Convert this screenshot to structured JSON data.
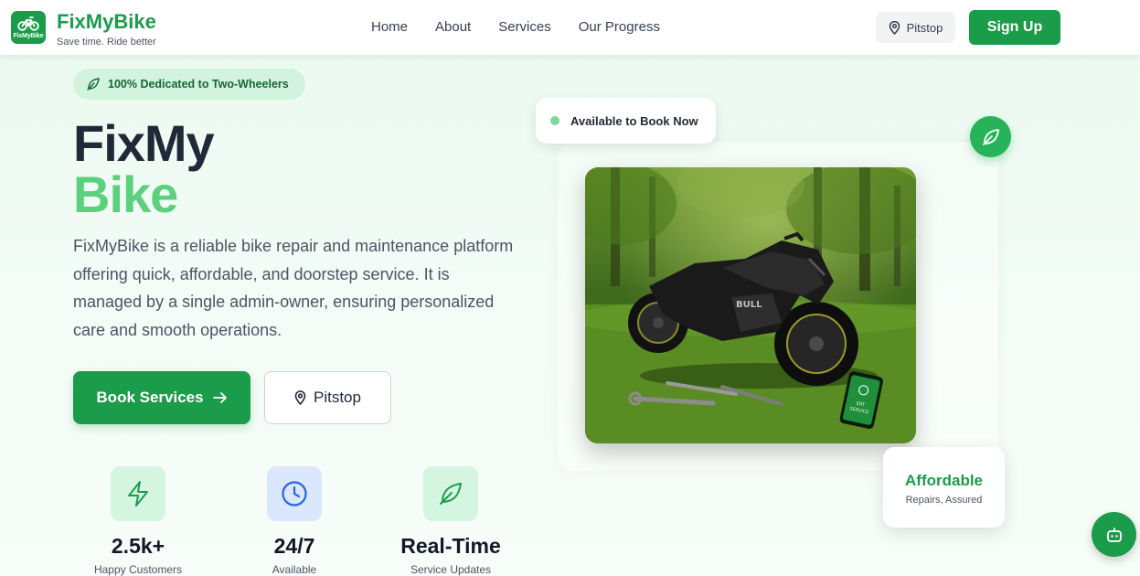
{
  "navbar": {
    "logo_mini_text": "FixMyBike",
    "brand_name": "FixMyBike",
    "tagline": "Save time. Ride better",
    "links": [
      "Home",
      "About",
      "Services",
      "Our Progress"
    ],
    "pitstop_label": "Pitstop",
    "signup_label": "Sign Up"
  },
  "hero": {
    "pill_label": "100% Dedicated to Two-Wheelers",
    "title_line1": "FixMy",
    "title_line2": "Bike",
    "description": "FixMyBike is a reliable bike repair and maintenance platform offering quick, affordable, and doorstep service. It is managed by a single admin-owner, ensuring personalized care and smooth operations.",
    "book_label": "Book Services",
    "pitstop_label": "Pitstop"
  },
  "stats": [
    {
      "icon": "lightning-icon",
      "value": "2.5k+",
      "label": "Happy Customers"
    },
    {
      "icon": "clock-icon",
      "value": "24/7",
      "label": "Available"
    },
    {
      "icon": "leaf-icon",
      "value": "Real-Time",
      "label": "Service Updates"
    }
  ],
  "showcase": {
    "available_label": "Available to Book Now",
    "afford_title": "Affordable",
    "afford_sub": "Repairs, Assured",
    "bike_text": "BULL",
    "phone_text_1": "ERT",
    "phone_text_2": "SERVICE"
  },
  "colors": {
    "brand_green": "#1b9c4a",
    "title_accent": "#5bd07e",
    "pill_bg": "#d2f4df"
  }
}
